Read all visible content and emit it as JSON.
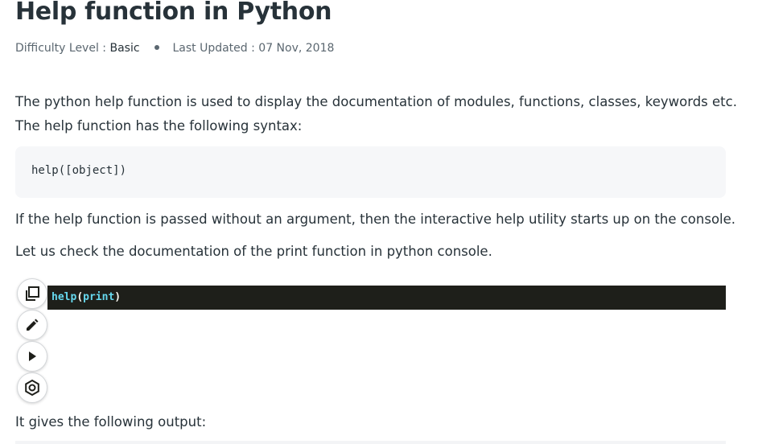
{
  "article": {
    "title": "Help function in Python",
    "meta": {
      "difficulty_label": "Difficulty Level : ",
      "difficulty_value": "Basic",
      "updated_label": "Last Updated : ",
      "updated_value": "07 Nov, 2018"
    },
    "paragraphs": {
      "intro_1": "The python help function is used to display the documentation of modules, functions, classes, keywords etc.",
      "intro_2": "The help function has the following syntax:",
      "no_argument": "If the help function is passed without an argument, then the interactive help utility starts up on the console.",
      "check_print": "Let us check the documentation of the print function in python console.",
      "output": "It gives the following output:"
    },
    "syntax_code": "help([object])",
    "code_example": {
      "fn": "help",
      "open": "(",
      "arg": "print",
      "close": ")"
    }
  },
  "code_toolbar": {
    "icons": [
      "copy-icon",
      "edit-icon",
      "run-icon",
      "settings-icon"
    ]
  },
  "colors": {
    "text": "#273239",
    "muted": "#5b6770",
    "code_bg": "#1e1f1a",
    "code_fn": "#66d9ef",
    "syntax_bg": "#f6f7f9"
  }
}
